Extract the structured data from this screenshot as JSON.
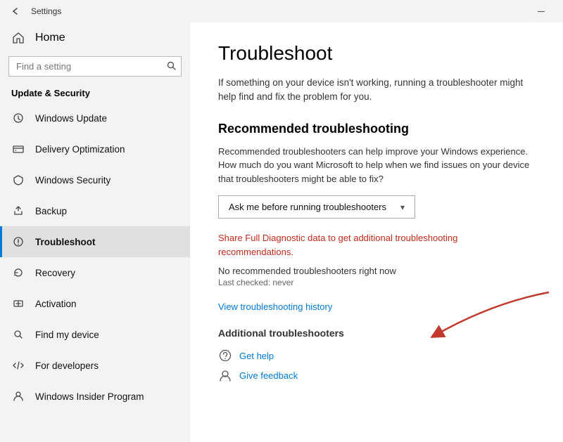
{
  "titlebar": {
    "title": "Settings",
    "minimize_label": "—"
  },
  "sidebar": {
    "home_label": "Home",
    "search_placeholder": "Find a setting",
    "section_header": "Update & Security",
    "items": [
      {
        "id": "windows-update",
        "label": "Windows Update",
        "icon": "update"
      },
      {
        "id": "delivery-optimization",
        "label": "Delivery Optimization",
        "icon": "delivery"
      },
      {
        "id": "windows-security",
        "label": "Windows Security",
        "icon": "shield"
      },
      {
        "id": "backup",
        "label": "Backup",
        "icon": "backup"
      },
      {
        "id": "troubleshoot",
        "label": "Troubleshoot",
        "icon": "troubleshoot",
        "active": true
      },
      {
        "id": "recovery",
        "label": "Recovery",
        "icon": "recovery"
      },
      {
        "id": "activation",
        "label": "Activation",
        "icon": "activation"
      },
      {
        "id": "find-my-device",
        "label": "Find my device",
        "icon": "finddevice"
      },
      {
        "id": "for-developers",
        "label": "For developers",
        "icon": "developer"
      },
      {
        "id": "windows-insider",
        "label": "Windows Insider Program",
        "icon": "insider"
      }
    ]
  },
  "content": {
    "page_title": "Troubleshoot",
    "page_subtitle": "If something on your device isn't working, running a troubleshooter might help find and fix the problem for you.",
    "recommended_section": {
      "title": "Recommended troubleshooting",
      "description": "Recommended troubleshooters can help improve your Windows experience. How much do you want Microsoft to help when we find issues on your device that troubleshooters might be able to fix?",
      "dropdown_value": "Ask me before running troubleshooters",
      "dropdown_chevron": "▾"
    },
    "diagnostic_link": "Share Full Diagnostic data to get additional troubleshooting recommendations.",
    "no_troubleshooters": "No recommended troubleshooters right now",
    "last_checked": "Last checked: never",
    "view_history_link": "View troubleshooting history",
    "additional_section_title": "Additional troubleshooters",
    "help_links": [
      {
        "id": "get-help",
        "label": "Get help",
        "icon": "help"
      },
      {
        "id": "give-feedback",
        "label": "Give feedback",
        "icon": "feedback"
      }
    ]
  }
}
